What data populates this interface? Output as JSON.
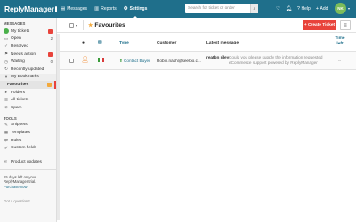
{
  "app": {
    "logo_text": "ReplyManager",
    "nav": [
      {
        "label": "Messages",
        "icon": "inbox-icon"
      },
      {
        "label": "Reports",
        "icon": "chart-icon"
      },
      {
        "label": "Settings",
        "icon": "gear-icon"
      }
    ],
    "search_placeholder": "Search for ticket or order",
    "help_label": "Help",
    "add_label": "Add",
    "avatar_initials": "NK"
  },
  "sidebar": {
    "messages_heading": "MESSAGES",
    "items": [
      {
        "label": "My tickets",
        "icon": "green-dot-icon",
        "badge": "red"
      },
      {
        "label": "Open",
        "icon": "folder-open-icon",
        "count": "2"
      },
      {
        "label": "Resolved",
        "icon": "check-icon",
        "count": ""
      },
      {
        "label": "Needs action",
        "icon": "flag-icon",
        "badge": "red"
      },
      {
        "label": "Waiting",
        "icon": "clock-icon",
        "count": "0"
      },
      {
        "label": "Recently updated",
        "icon": "refresh-icon",
        "count": ""
      },
      {
        "label": "My Bookmarks",
        "icon": "bookmark-icon",
        "count": ""
      },
      {
        "label": "Favourites",
        "icon": "",
        "badge": "orange"
      },
      {
        "label": "Folders",
        "icon": "folder-icon",
        "count": ""
      },
      {
        "label": "All tickets",
        "icon": "list-icon",
        "count": ""
      },
      {
        "label": "Spam",
        "icon": "spam-icon",
        "count": ""
      }
    ],
    "tools_heading": "TOOLS",
    "tools": [
      {
        "label": "Snippets",
        "icon": "snippet-icon"
      },
      {
        "label": "Templates",
        "icon": "template-icon"
      },
      {
        "label": "Rules",
        "icon": "rules-icon"
      },
      {
        "label": "Custom fields",
        "icon": "fields-icon"
      }
    ],
    "product_updates": "Product updates",
    "trial_text": "15 days left on your ReplyManager trial.",
    "trial_link": "Purchase now",
    "question_text": "Got a question?"
  },
  "main": {
    "title": "Favourites",
    "create_label": "+ Create Ticket",
    "columns": {
      "type": "Type",
      "customer": "Customer",
      "latest": "Latest message",
      "time_left": "Time left"
    },
    "rows": [
      {
        "type": "Contact Buyer",
        "customer": "Robin.nash@seeloo.c...",
        "sender": "reatbn riley",
        "snippet": "Could you please supply the information requested eCommerce support powered by ReplyManager",
        "time_left": "--"
      }
    ]
  }
}
